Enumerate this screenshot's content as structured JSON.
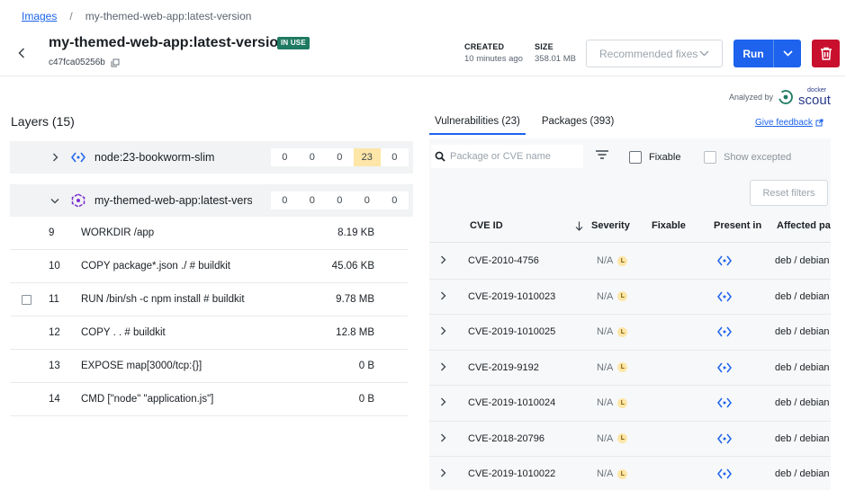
{
  "breadcrumb": {
    "link": "Images",
    "separator": "/",
    "current": "my-themed-web-app:latest-version"
  },
  "header": {
    "title": "my-themed-web-app:latest-version",
    "badge": "IN USE",
    "digest": "c47fca05256b",
    "created_label": "CREATED",
    "created_value": "10 minutes ago",
    "size_label": "SIZE",
    "size_value": "358.01 MB",
    "recommended_fixes": "Recommended fixes",
    "run": "Run"
  },
  "analyzed": {
    "label": "Analyzed by",
    "brand_top": "docker",
    "brand_main": "scout"
  },
  "layers": {
    "title": "Layers (15)",
    "groups": [
      {
        "name_prefix": "node",
        "name_sep": ":",
        "name_rest": "23-bookworm-slim",
        "counts": [
          "0",
          "0",
          "0",
          "23",
          "0"
        ],
        "highlight_index": 3
      },
      {
        "name_prefix": "my-themed-web-app",
        "name_sep": ":",
        "name_rest": "latest-vers...",
        "counts": [
          "0",
          "0",
          "0",
          "0",
          "0"
        ]
      }
    ],
    "rows": [
      {
        "num": "9",
        "cmd": "WORKDIR /app",
        "size": "8.19 KB"
      },
      {
        "num": "10",
        "cmd": "COPY package*.json ./ # buildkit",
        "size": "45.06 KB"
      },
      {
        "num": "11",
        "cmd": "RUN /bin/sh -c npm install # buildkit",
        "size": "9.78 MB"
      },
      {
        "num": "12",
        "cmd": "COPY . . # buildkit",
        "size": "12.8 MB"
      },
      {
        "num": "13",
        "cmd": "EXPOSE map[3000/tcp:{}]",
        "size": "0 B"
      },
      {
        "num": "14",
        "cmd": "CMD [\"node\" \"application.js\"]",
        "size": "0 B"
      }
    ]
  },
  "tabs": {
    "vulnerabilities": "Vulnerabilities (23)",
    "packages": "Packages (393)",
    "feedback": "Give feedback"
  },
  "filters": {
    "search_placeholder": "Package or CVE name",
    "fixable": "Fixable",
    "show_excepted": "Show excepted",
    "reset": "Reset filters"
  },
  "table": {
    "headers": {
      "cve": "CVE ID",
      "severity": "Severity",
      "fixable": "Fixable",
      "present": "Present in",
      "affected": "Affected pac"
    },
    "rows": [
      {
        "cve": "CVE-2010-4756",
        "severity": "N/A",
        "level": "L",
        "affected": "deb / debian"
      },
      {
        "cve": "CVE-2019-1010023",
        "severity": "N/A",
        "level": "L",
        "affected": "deb / debian"
      },
      {
        "cve": "CVE-2019-1010025",
        "severity": "N/A",
        "level": "L",
        "affected": "deb / debian"
      },
      {
        "cve": "CVE-2019-9192",
        "severity": "N/A",
        "level": "L",
        "affected": "deb / debian"
      },
      {
        "cve": "CVE-2019-1010024",
        "severity": "N/A",
        "level": "L",
        "affected": "deb / debian"
      },
      {
        "cve": "CVE-2018-20796",
        "severity": "N/A",
        "level": "L",
        "affected": "deb / debian"
      },
      {
        "cve": "CVE-2019-1010022",
        "severity": "N/A",
        "level": "L",
        "affected": "deb / debian"
      }
    ]
  },
  "colors": {
    "accent": "#1d63ed",
    "danger": "#c8102e",
    "badge": "#1f7a62",
    "highlight": "#fde6a8"
  }
}
